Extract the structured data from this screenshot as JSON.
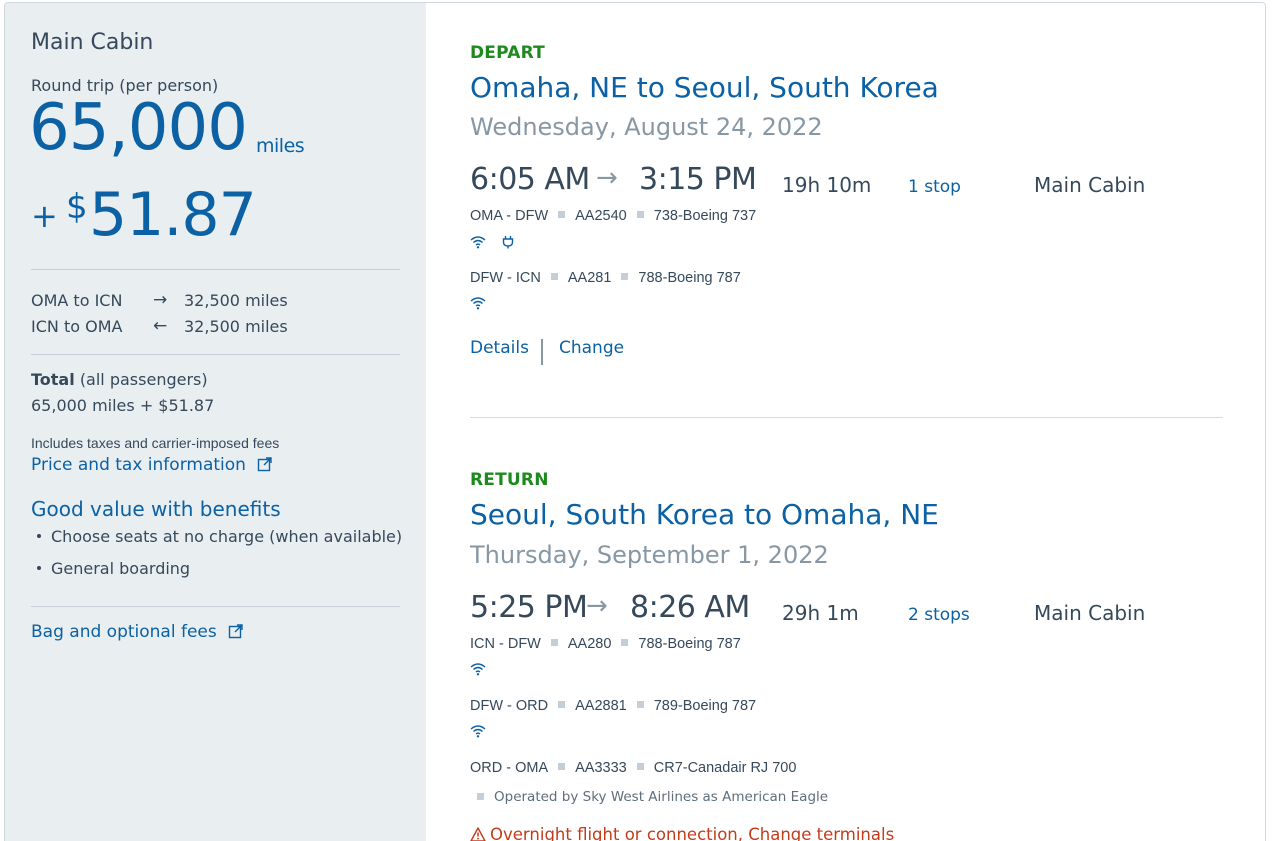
{
  "summary": {
    "cabin": "Main Cabin",
    "trip_type": "Round trip (per person)",
    "miles": "65,000",
    "miles_unit": "miles",
    "plus": "+",
    "currency": "$",
    "amount": "51.87",
    "legs": [
      {
        "label": "OMA to ICN",
        "arrow": "→",
        "value": "32,500 miles"
      },
      {
        "label": "ICN to OMA",
        "arrow": "←",
        "value": "32,500 miles"
      }
    ],
    "total_label": "Total",
    "total_suffix": "(all passengers)",
    "total_value": "65,000 miles + $51.87",
    "fees_note": "Includes taxes and carrier-imposed fees",
    "price_link": "Price and tax information",
    "benefits_title": "Good value with benefits",
    "benefits": [
      "Choose seats at no charge (when available)",
      "General boarding"
    ],
    "bag_link": "Bag and optional fees"
  },
  "depart": {
    "label": "DEPART",
    "route": "Omaha, NE to Seoul, South Korea",
    "date": "Wednesday, August 24, 2022",
    "depart_time": "6:05 AM",
    "arrive_time": "3:15 PM",
    "duration": "19h 10m",
    "stops": "1 stop",
    "cabin": "Main Cabin",
    "segments": [
      {
        "route": "OMA - DFW",
        "flight": "AA2540",
        "aircraft": "738-Boeing 737",
        "amenities": [
          "wifi-icon",
          "power-icon"
        ]
      },
      {
        "route": "DFW - ICN",
        "flight": "AA281",
        "aircraft": "788-Boeing 787",
        "amenities": [
          "wifi-icon"
        ]
      }
    ],
    "details_link": "Details",
    "change_link": "Change"
  },
  "return": {
    "label": "RETURN",
    "route": "Seoul, South Korea to Omaha, NE",
    "date": "Thursday, September 1, 2022",
    "depart_time": "5:25 PM",
    "arrive_time": "8:26 AM",
    "duration": "29h 1m",
    "stops": "2 stops",
    "cabin": "Main Cabin",
    "segments": [
      {
        "route": "ICN - DFW",
        "flight": "AA280",
        "aircraft": "788-Boeing 787",
        "amenities": [
          "wifi-icon"
        ]
      },
      {
        "route": "DFW - ORD",
        "flight": "AA2881",
        "aircraft": "789-Boeing 787",
        "amenities": [
          "wifi-icon"
        ]
      },
      {
        "route": "ORD - OMA",
        "flight": "AA3333",
        "aircraft": "CR7-Canadair RJ 700",
        "amenities": []
      }
    ],
    "operated_by": "Operated by Sky West Airlines as American Eagle",
    "warning": "Overnight flight or connection, Change terminals"
  },
  "colors": {
    "brand_blue": "#0b61a4",
    "depart_green": "#1e8a1e",
    "warning_red": "#c23c1a",
    "panel_bg": "#e9eef1"
  }
}
